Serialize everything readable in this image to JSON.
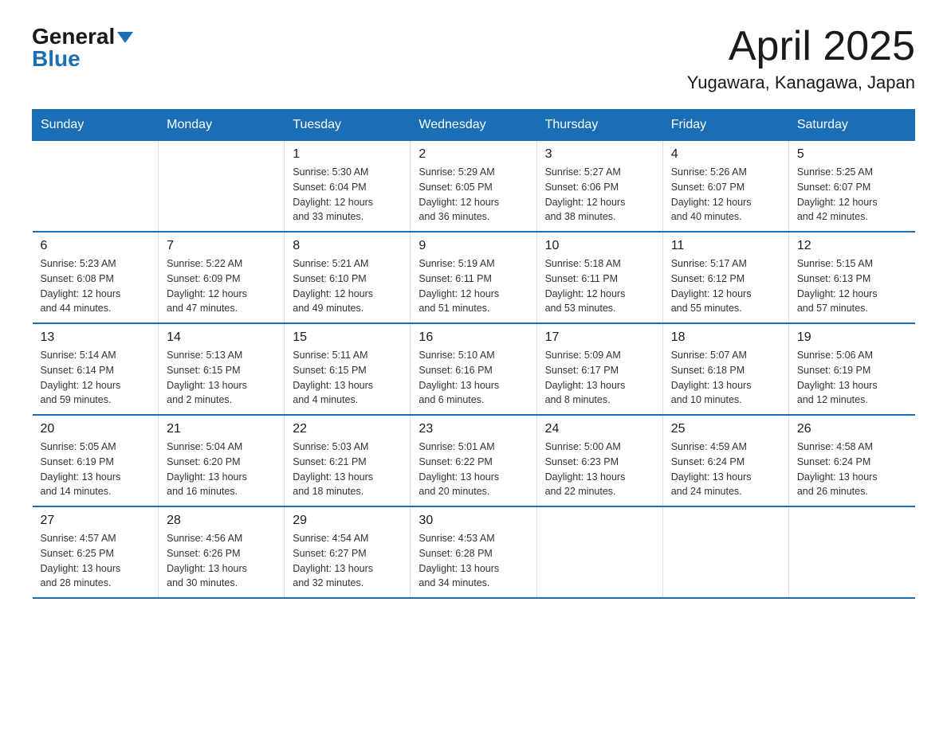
{
  "header": {
    "logo_general": "General",
    "logo_blue": "Blue",
    "title": "April 2025",
    "subtitle": "Yugawara, Kanagawa, Japan"
  },
  "calendar": {
    "headers": [
      "Sunday",
      "Monday",
      "Tuesday",
      "Wednesday",
      "Thursday",
      "Friday",
      "Saturday"
    ],
    "weeks": [
      [
        {
          "day": "",
          "info": ""
        },
        {
          "day": "",
          "info": ""
        },
        {
          "day": "1",
          "info": "Sunrise: 5:30 AM\nSunset: 6:04 PM\nDaylight: 12 hours\nand 33 minutes."
        },
        {
          "day": "2",
          "info": "Sunrise: 5:29 AM\nSunset: 6:05 PM\nDaylight: 12 hours\nand 36 minutes."
        },
        {
          "day": "3",
          "info": "Sunrise: 5:27 AM\nSunset: 6:06 PM\nDaylight: 12 hours\nand 38 minutes."
        },
        {
          "day": "4",
          "info": "Sunrise: 5:26 AM\nSunset: 6:07 PM\nDaylight: 12 hours\nand 40 minutes."
        },
        {
          "day": "5",
          "info": "Sunrise: 5:25 AM\nSunset: 6:07 PM\nDaylight: 12 hours\nand 42 minutes."
        }
      ],
      [
        {
          "day": "6",
          "info": "Sunrise: 5:23 AM\nSunset: 6:08 PM\nDaylight: 12 hours\nand 44 minutes."
        },
        {
          "day": "7",
          "info": "Sunrise: 5:22 AM\nSunset: 6:09 PM\nDaylight: 12 hours\nand 47 minutes."
        },
        {
          "day": "8",
          "info": "Sunrise: 5:21 AM\nSunset: 6:10 PM\nDaylight: 12 hours\nand 49 minutes."
        },
        {
          "day": "9",
          "info": "Sunrise: 5:19 AM\nSunset: 6:11 PM\nDaylight: 12 hours\nand 51 minutes."
        },
        {
          "day": "10",
          "info": "Sunrise: 5:18 AM\nSunset: 6:11 PM\nDaylight: 12 hours\nand 53 minutes."
        },
        {
          "day": "11",
          "info": "Sunrise: 5:17 AM\nSunset: 6:12 PM\nDaylight: 12 hours\nand 55 minutes."
        },
        {
          "day": "12",
          "info": "Sunrise: 5:15 AM\nSunset: 6:13 PM\nDaylight: 12 hours\nand 57 minutes."
        }
      ],
      [
        {
          "day": "13",
          "info": "Sunrise: 5:14 AM\nSunset: 6:14 PM\nDaylight: 12 hours\nand 59 minutes."
        },
        {
          "day": "14",
          "info": "Sunrise: 5:13 AM\nSunset: 6:15 PM\nDaylight: 13 hours\nand 2 minutes."
        },
        {
          "day": "15",
          "info": "Sunrise: 5:11 AM\nSunset: 6:15 PM\nDaylight: 13 hours\nand 4 minutes."
        },
        {
          "day": "16",
          "info": "Sunrise: 5:10 AM\nSunset: 6:16 PM\nDaylight: 13 hours\nand 6 minutes."
        },
        {
          "day": "17",
          "info": "Sunrise: 5:09 AM\nSunset: 6:17 PM\nDaylight: 13 hours\nand 8 minutes."
        },
        {
          "day": "18",
          "info": "Sunrise: 5:07 AM\nSunset: 6:18 PM\nDaylight: 13 hours\nand 10 minutes."
        },
        {
          "day": "19",
          "info": "Sunrise: 5:06 AM\nSunset: 6:19 PM\nDaylight: 13 hours\nand 12 minutes."
        }
      ],
      [
        {
          "day": "20",
          "info": "Sunrise: 5:05 AM\nSunset: 6:19 PM\nDaylight: 13 hours\nand 14 minutes."
        },
        {
          "day": "21",
          "info": "Sunrise: 5:04 AM\nSunset: 6:20 PM\nDaylight: 13 hours\nand 16 minutes."
        },
        {
          "day": "22",
          "info": "Sunrise: 5:03 AM\nSunset: 6:21 PM\nDaylight: 13 hours\nand 18 minutes."
        },
        {
          "day": "23",
          "info": "Sunrise: 5:01 AM\nSunset: 6:22 PM\nDaylight: 13 hours\nand 20 minutes."
        },
        {
          "day": "24",
          "info": "Sunrise: 5:00 AM\nSunset: 6:23 PM\nDaylight: 13 hours\nand 22 minutes."
        },
        {
          "day": "25",
          "info": "Sunrise: 4:59 AM\nSunset: 6:24 PM\nDaylight: 13 hours\nand 24 minutes."
        },
        {
          "day": "26",
          "info": "Sunrise: 4:58 AM\nSunset: 6:24 PM\nDaylight: 13 hours\nand 26 minutes."
        }
      ],
      [
        {
          "day": "27",
          "info": "Sunrise: 4:57 AM\nSunset: 6:25 PM\nDaylight: 13 hours\nand 28 minutes."
        },
        {
          "day": "28",
          "info": "Sunrise: 4:56 AM\nSunset: 6:26 PM\nDaylight: 13 hours\nand 30 minutes."
        },
        {
          "day": "29",
          "info": "Sunrise: 4:54 AM\nSunset: 6:27 PM\nDaylight: 13 hours\nand 32 minutes."
        },
        {
          "day": "30",
          "info": "Sunrise: 4:53 AM\nSunset: 6:28 PM\nDaylight: 13 hours\nand 34 minutes."
        },
        {
          "day": "",
          "info": ""
        },
        {
          "day": "",
          "info": ""
        },
        {
          "day": "",
          "info": ""
        }
      ]
    ]
  }
}
